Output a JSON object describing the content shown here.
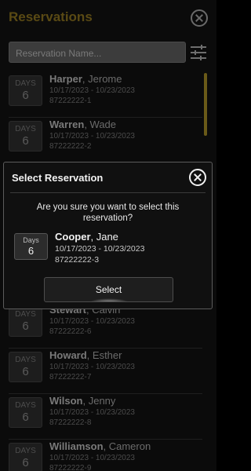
{
  "header": {
    "title": "Reservations"
  },
  "search": {
    "placeholder": "Reservation Name..."
  },
  "reservations": [
    {
      "days_label": "DAYS",
      "days": "6",
      "last": "Harper",
      "first": ", Jerome",
      "dates": "10/17/2023 - 10/23/2023",
      "conf": "87222222-1"
    },
    {
      "days_label": "DAYS",
      "days": "6",
      "last": "Warren",
      "first": ", Wade",
      "dates": "10/17/2023 - 10/23/2023",
      "conf": "87222222-2"
    },
    {
      "days_label": "DAYS",
      "days": "6",
      "last": "Stewart",
      "first": ", Calvin",
      "dates": "10/17/2023 - 10/23/2023",
      "conf": "87222222-6"
    },
    {
      "days_label": "DAYS",
      "days": "6",
      "last": "Howard",
      "first": ", Esther",
      "dates": "10/17/2023 - 10/23/2023",
      "conf": "87222222-7"
    },
    {
      "days_label": "DAYS",
      "days": "6",
      "last": "Wilson",
      "first": ", Jenny",
      "dates": "10/17/2023 - 10/23/2023",
      "conf": "87222222-8"
    },
    {
      "days_label": "DAYS",
      "days": "6",
      "last": "Williamson",
      "first": ", Cameron",
      "dates": "10/17/2023 - 10/23/2023",
      "conf": "87222222-9"
    }
  ],
  "modal": {
    "title": "Select Reservation",
    "question": "Are you sure you want to select this reservation?",
    "days_label": "Days",
    "days": "6",
    "last": "Cooper",
    "first": ", Jane",
    "dates": "10/17/2023 - 10/23/2023",
    "conf": "87222222-3",
    "select_label": "Select"
  },
  "icons": {
    "close": "close-icon",
    "filter": "filter-sliders-icon"
  },
  "colors": {
    "accent": "#e0b32a",
    "background": "#000000",
    "modal_border": "#5c5c5c"
  }
}
